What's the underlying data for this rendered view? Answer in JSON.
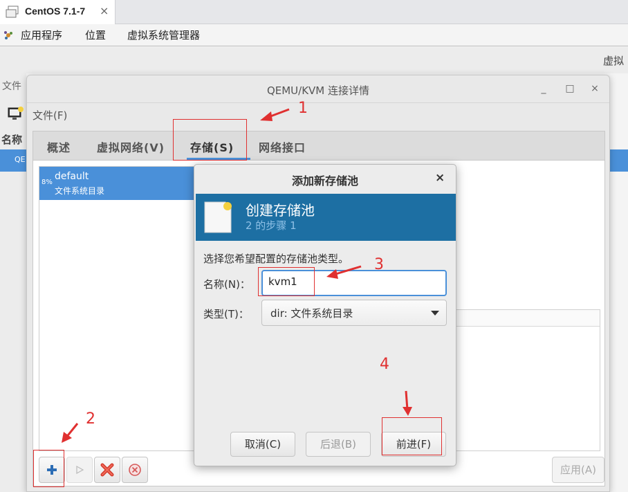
{
  "vm_tab": {
    "title": "CentOS 7.1-7",
    "close": "×"
  },
  "gnome_menu": {
    "applications": "应用程序",
    "places": "位置",
    "vmm": "虚拟系统管理器"
  },
  "background": {
    "right_label": "虚拟",
    "file_menu": "文件",
    "name_header": "名称",
    "row_prefix": "QE"
  },
  "conn_window": {
    "title": "QEMU/KVM 连接详情",
    "minimize": "_",
    "maximize": "□",
    "close": "×",
    "menu_file": "文件(F)",
    "tabs": [
      "概述",
      "虚拟网络(V)",
      "存储(S)",
      "网络接口"
    ],
    "active_tab": 2,
    "pools": [
      {
        "usage": "8%",
        "name": "default",
        "type": "文件系统目录"
      }
    ],
    "apply_label": "应用(A)"
  },
  "dialog": {
    "title": "添加新存储池",
    "close": "×",
    "banner_title": "创建存储池",
    "banner_step": "2 的步骤 1",
    "prompt": "选择您希望配置的存储池类型。",
    "name_label": "名称(N)：",
    "name_value": "kvm1",
    "type_label": "类型(T)：",
    "type_value": "dir: 文件系统目录",
    "cancel_label": "取消(C)",
    "back_label": "后退(B)",
    "forward_label": "前进(F)"
  },
  "annotations": {
    "n1": "1",
    "n2": "2",
    "n3": "3",
    "n4": "4"
  },
  "colors": {
    "accent": "#4a90d9",
    "banner": "#1d6fa3",
    "annotation": "#e03030"
  }
}
